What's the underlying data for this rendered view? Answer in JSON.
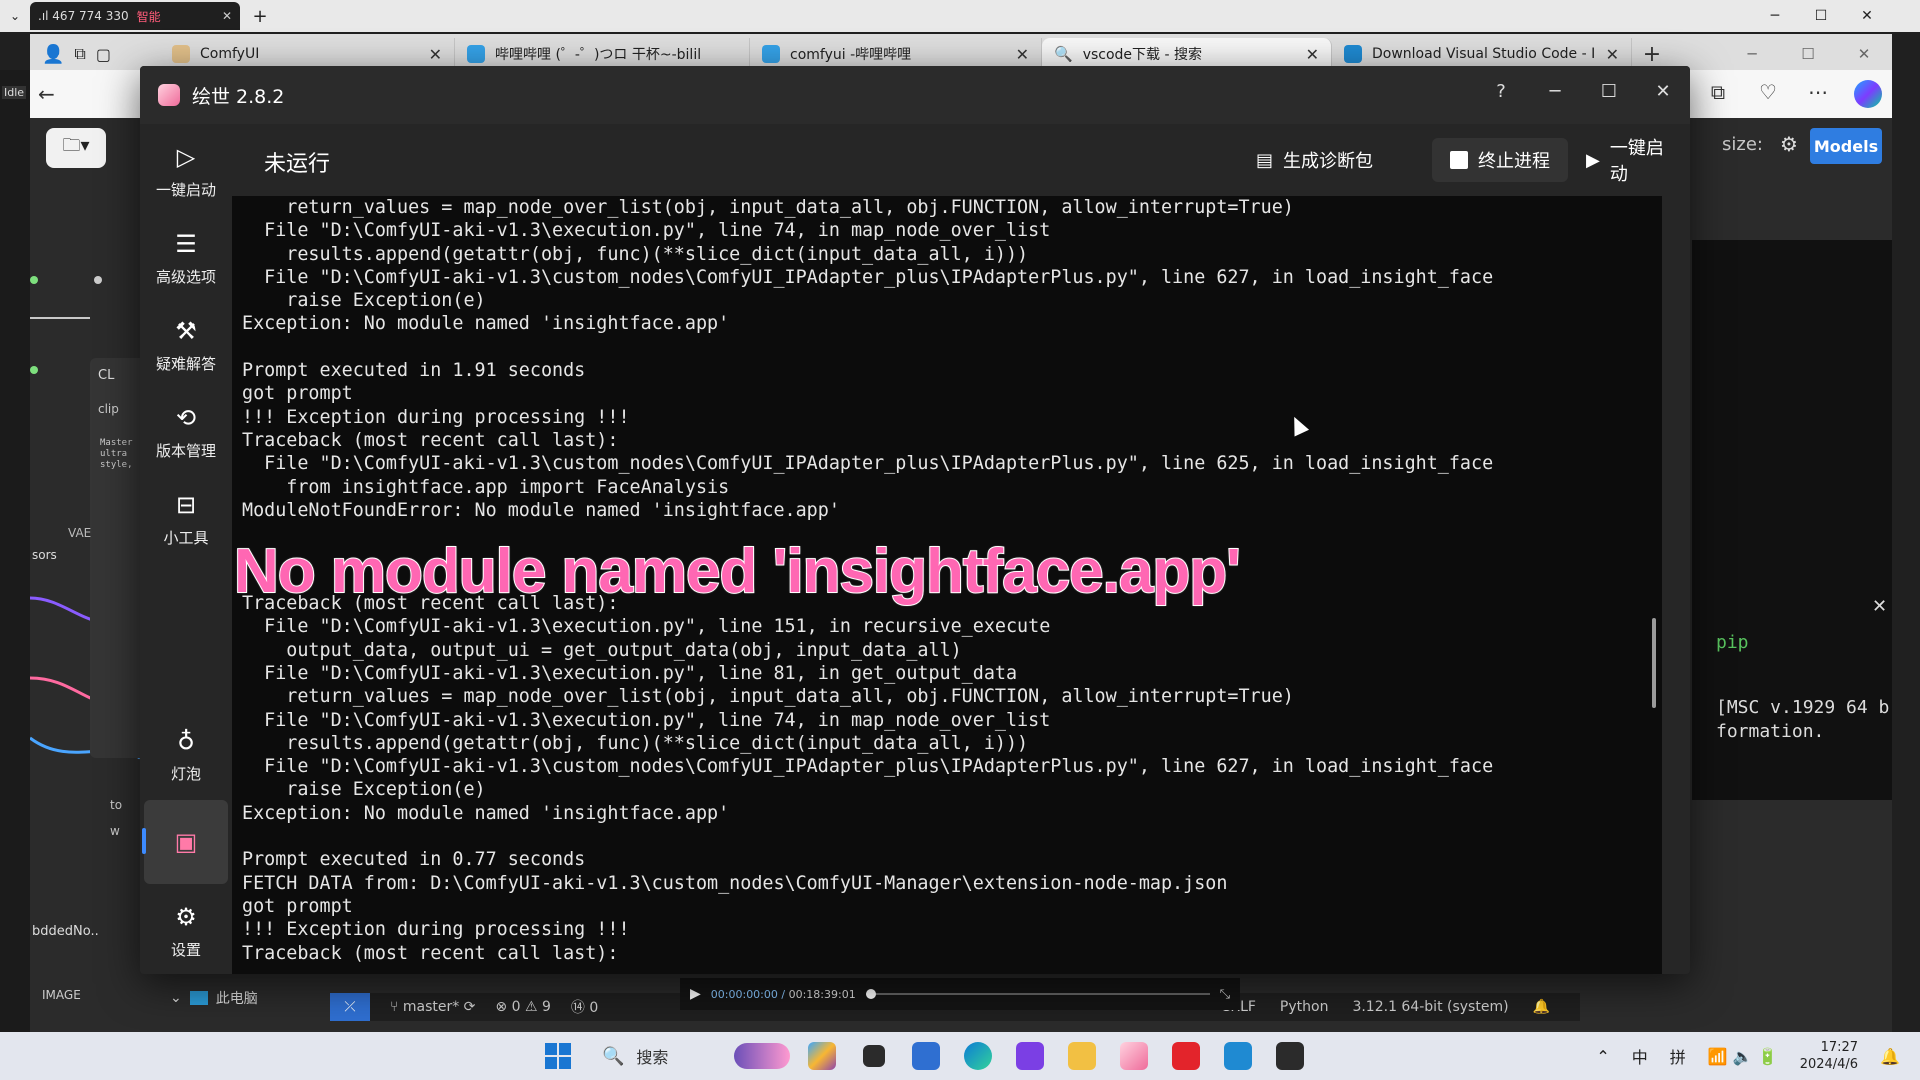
{
  "browser": {
    "mini_tab": {
      "signal": ".ıl 467 774 330",
      "badge": "智能"
    },
    "tabs": [
      {
        "label": "ComfyUI",
        "color": "#e2c08a"
      },
      {
        "label": "哔哩哔哩 (゜-゜)つロ 干杯~-bilil",
        "color": "#35a2e8"
      },
      {
        "label": "comfyui -哔哩哔哩",
        "color": "#35a2e8"
      },
      {
        "label": "vscode下载 - 搜索",
        "color": "#1e78c8"
      },
      {
        "label": "Download Visual Studio Code - I",
        "color": "#1f8ad2"
      }
    ]
  },
  "comfy": {
    "size_label": "size:",
    "models_button": "Models",
    "left_labels": {
      "cl": "CL",
      "clip": "clip",
      "vae": "VAE",
      "sors": "sors",
      "to": "to",
      "w": "w",
      "node": "bddedNo..",
      "image": "IMAGE"
    },
    "node_text": "Master\nultra\nstyle,",
    "terminal_pip": "pip",
    "terminal_msc": "[MSC v.1929 64 b\nformation.",
    "explorer": "此电脑",
    "status": {
      "branch": "master*",
      "errors": "⊗ 0 ⚠ 9",
      "ports": "⑭ 0",
      "eol": "CRLF",
      "lang": "Python",
      "interp": "3.12.1 64-bit (system)"
    }
  },
  "player": {
    "current": "00:00:00:00",
    "total": "00:18:39:01"
  },
  "app": {
    "title": "绘世 2.8.2",
    "status": "未运行",
    "buttons": {
      "diag": "生成诊断包",
      "stop": "终止进程",
      "start": "一键启动"
    },
    "sidebar": [
      {
        "label": "一键启动",
        "icon": "play-icon"
      },
      {
        "label": "高级选项",
        "icon": "list-icon"
      },
      {
        "label": "疑难解答",
        "icon": "tools-icon"
      },
      {
        "label": "版本管理",
        "icon": "history-icon"
      },
      {
        "label": "小工具",
        "icon": "toolbox-icon"
      },
      {
        "label": "灯泡",
        "icon": "bulb-icon"
      },
      {
        "label": "",
        "icon": "terminal-icon"
      },
      {
        "label": "设置",
        "icon": "gear-icon"
      }
    ],
    "console_lines": [
      "    return_values = map_node_over_list(obj, input_data_all, obj.FUNCTION, allow_interrupt=True)",
      "  File \"D:\\ComfyUI-aki-v1.3\\execution.py\", line 74, in map_node_over_list",
      "    results.append(getattr(obj, func)(**slice_dict(input_data_all, i)))",
      "  File \"D:\\ComfyUI-aki-v1.3\\custom_nodes\\ComfyUI_IPAdapter_plus\\IPAdapterPlus.py\", line 627, in load_insight_face",
      "    raise Exception(e)",
      "Exception: No module named 'insightface.app'",
      "",
      "Prompt executed in 1.91 seconds",
      "got prompt",
      "!!! Exception during processing !!!",
      "Traceback (most recent call last):",
      "  File \"D:\\ComfyUI-aki-v1.3\\custom_nodes\\ComfyUI_IPAdapter_plus\\IPAdapterPlus.py\", line 625, in load_insight_face",
      "    from insightface.app import FaceAnalysis",
      "ModuleNotFoundError: No module named 'insightface.app'",
      "",
      "",
      "",
      "Traceback (most recent call last):",
      "  File \"D:\\ComfyUI-aki-v1.3\\execution.py\", line 151, in recursive_execute",
      "    output_data, output_ui = get_output_data(obj, input_data_all)",
      "  File \"D:\\ComfyUI-aki-v1.3\\execution.py\", line 81, in get_output_data",
      "    return_values = map_node_over_list(obj, input_data_all, obj.FUNCTION, allow_interrupt=True)",
      "  File \"D:\\ComfyUI-aki-v1.3\\execution.py\", line 74, in map_node_over_list",
      "    results.append(getattr(obj, func)(**slice_dict(input_data_all, i)))",
      "  File \"D:\\ComfyUI-aki-v1.3\\custom_nodes\\ComfyUI_IPAdapter_plus\\IPAdapterPlus.py\", line 627, in load_insight_face",
      "    raise Exception(e)",
      "Exception: No module named 'insightface.app'",
      "",
      "Prompt executed in 0.77 seconds",
      "FETCH DATA from: D:\\ComfyUI-aki-v1.3\\custom_nodes\\ComfyUI-Manager\\extension-node-map.json",
      "got prompt",
      "!!! Exception during processing !!!",
      "Traceback (most recent call last):"
    ],
    "overlay_caption": "No module named 'insightface.app'"
  },
  "taskbar": {
    "search_placeholder": "搜索",
    "ime1": "中",
    "ime2": "拼",
    "time": "17:27",
    "date": "2024/4/6"
  }
}
